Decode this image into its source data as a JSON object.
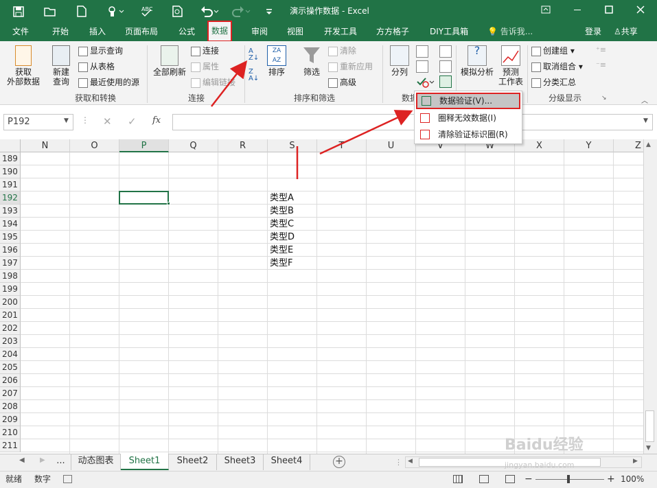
{
  "window": {
    "title": "演示操作数据 - Excel",
    "qat_icons": [
      "save-icon",
      "open-icon",
      "new-icon",
      "touch-mode-icon",
      "spelling-icon",
      "print-preview-icon",
      "undo-icon",
      "redo-icon",
      "customize-icon"
    ],
    "controls": [
      "restore-icon",
      "minimize-icon",
      "maximize-icon",
      "close-icon"
    ]
  },
  "tabs": [
    "文件",
    "开始",
    "插入",
    "页面布局",
    "公式",
    "数据",
    "审阅",
    "视图",
    "开发工具",
    "方方格子",
    "DIY工具箱"
  ],
  "active_tab": "数据",
  "tell_me": "告诉我...",
  "sign_in": "登录",
  "share": "共享",
  "ribbon": {
    "get_external": "获取\n外部数据",
    "new_query": "新建\n查询",
    "show_queries": "显示查询",
    "from_table": "从表格",
    "recent_sources": "最近使用的源",
    "group_get": "获取和转换",
    "refresh_all": "全部刷新",
    "connections": "连接",
    "properties": "属性",
    "edit_links": "编辑链接",
    "group_conn": "连接",
    "sort": "排序",
    "filter": "筛选",
    "clear": "清除",
    "reapply": "重新应用",
    "advanced": "高级",
    "group_sort": "排序和筛选",
    "text_to_columns": "分列",
    "group_tools": "数据",
    "what_if": "模拟分析",
    "forecast_sheet": "预测\n工作表",
    "group": "创建组",
    "ungroup": "取消组合",
    "subtotal": "分类汇总",
    "group_outline": "分级显示"
  },
  "dv_menu": [
    "数据验证(V)...",
    "圈释无效数据(I)",
    "清除验证标识圈(R)"
  ],
  "namebox": "P192",
  "fx": "fx",
  "columns": [
    "N",
    "O",
    "P",
    "Q",
    "R",
    "S",
    "T",
    "U",
    "V",
    "W",
    "X",
    "Y",
    "Z"
  ],
  "selected_col": "P",
  "rows": [
    "189",
    "190",
    "191",
    "192",
    "193",
    "194",
    "195",
    "196",
    "197",
    "198",
    "199",
    "200",
    "201",
    "202",
    "203",
    "204",
    "205",
    "206",
    "207",
    "208",
    "209",
    "210",
    "211"
  ],
  "selected_row": "192",
  "cells_S": [
    "类型A",
    "类型B",
    "类型C",
    "类型D",
    "类型E",
    "类型F"
  ],
  "sheet_tabs": [
    "...",
    "动态图表",
    "Sheet1",
    "Sheet2",
    "Sheet3",
    "Sheet4"
  ],
  "active_sheet": "Sheet1",
  "status": {
    "ready": "就绪",
    "num": "数字",
    "zoom": "100%"
  },
  "watermark": "Baidu经验",
  "watermark_url": "jingyan.baidu.com"
}
